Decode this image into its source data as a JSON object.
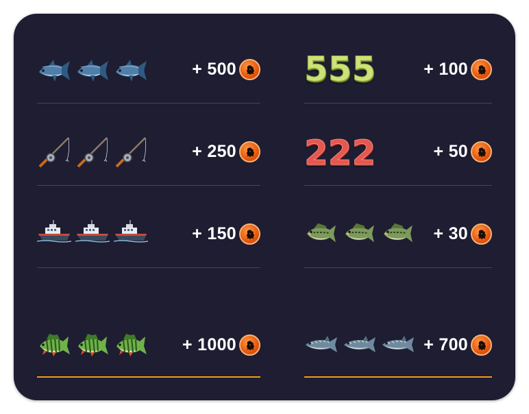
{
  "paytable": {
    "left": [
      {
        "icon": "fish-icon",
        "count": 3,
        "payout": "+ 500"
      },
      {
        "icon": "fishing-rod-icon",
        "count": 3,
        "payout": "+ 250"
      },
      {
        "icon": "boat-icon",
        "count": 3,
        "payout": "+ 150"
      },
      {
        "icon": "perch-icon",
        "count": 3,
        "payout": "+ 1000"
      }
    ],
    "right": [
      {
        "symbol": "555",
        "payout": "+ 100"
      },
      {
        "symbol": "222",
        "payout": "+ 50"
      },
      {
        "icon": "bass-icon",
        "count": 3,
        "payout": "+ 30"
      },
      {
        "icon": "pike-icon",
        "count": 3,
        "payout": "+ 700"
      }
    ]
  },
  "coin_icon": "coin-icon",
  "colors": {
    "panel_background": "#1e1d32",
    "divider": "#45455a",
    "highlight_divider": "#f39a17",
    "coin": "#e5560e",
    "text": "#ffffff"
  }
}
